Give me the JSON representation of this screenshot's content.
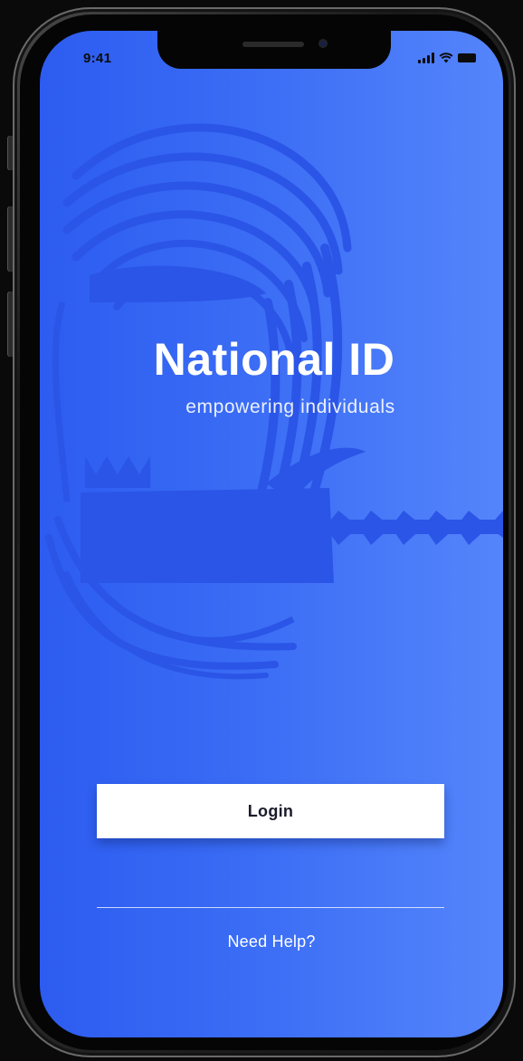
{
  "status_bar": {
    "time": "9:41",
    "icons": [
      "signal-icon",
      "wifi-icon",
      "battery-icon"
    ]
  },
  "app": {
    "title": "National ID",
    "tagline": "empowering individuals",
    "background_gradient": [
      "#2d5cf0",
      "#5585fb"
    ],
    "emblem_icon": "bird-of-paradise-emblem-icon"
  },
  "actions": {
    "login_label": "Login",
    "help_label": "Need Help?"
  },
  "colors": {
    "primary": "#3a6cf5",
    "button_bg": "#ffffff",
    "button_text": "#1a1a2a"
  }
}
